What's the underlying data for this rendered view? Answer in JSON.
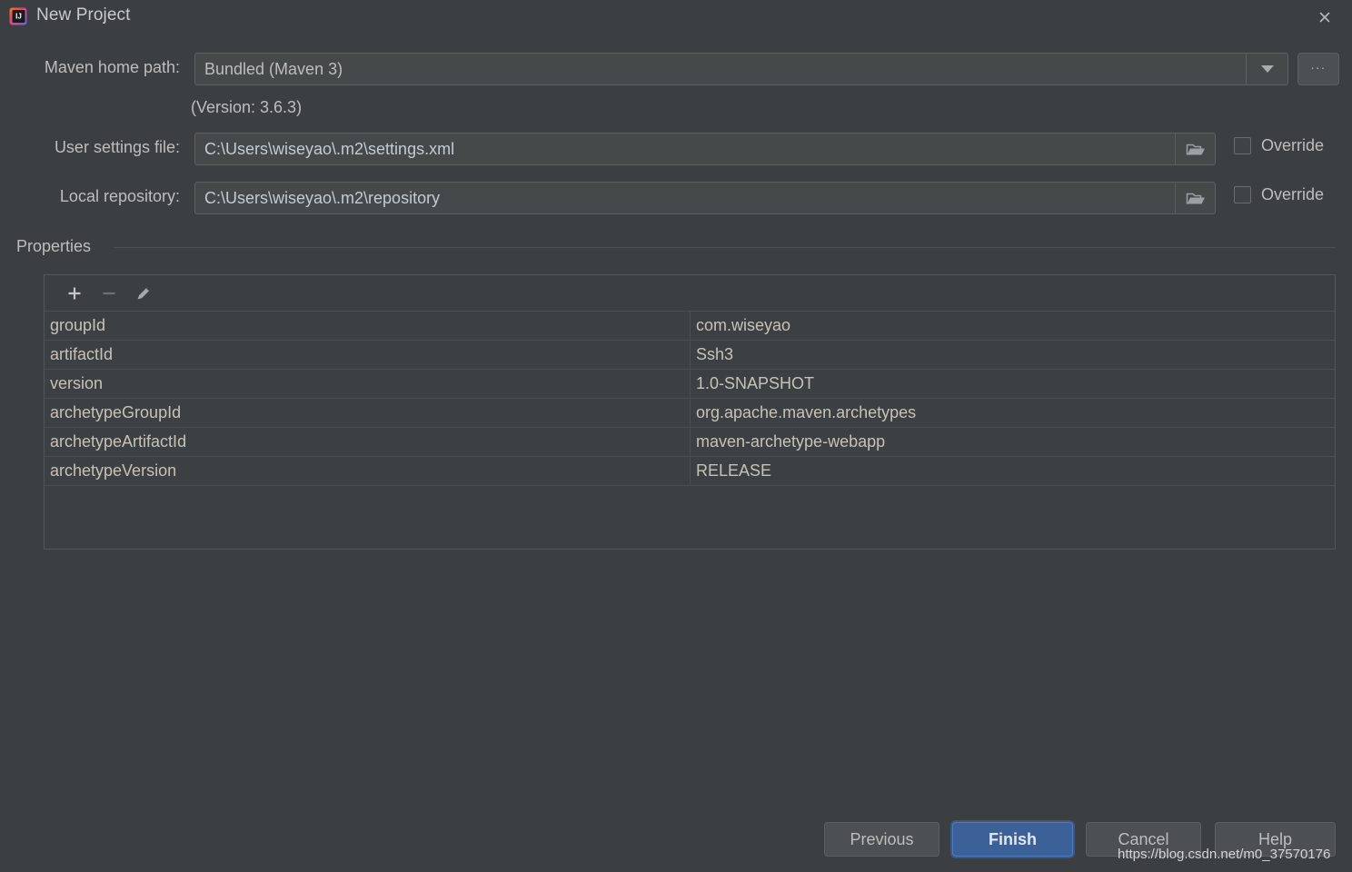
{
  "window": {
    "title": "New Project",
    "app_icon": "intellij-idea-icon",
    "close_icon": "close-icon",
    "background_color": "#3c3f41"
  },
  "form": {
    "maven_home": {
      "label": "Maven home path:",
      "value": "Bundled (Maven 3)",
      "dropdown_icon": "chevron-down-icon",
      "browse_label": "...",
      "version_note": "(Version: 3.6.3)"
    },
    "user_settings": {
      "label": "User settings file:",
      "value": "C:\\Users\\wiseyao\\.m2\\settings.xml",
      "folder_icon": "folder-icon",
      "override_label": "Override",
      "override_checked": false
    },
    "local_repository": {
      "label": "Local repository:",
      "value": "C:\\Users\\wiseyao\\.m2\\repository",
      "folder_icon": "folder-icon",
      "override_label": "Override",
      "override_checked": false
    }
  },
  "properties": {
    "section_title": "Properties",
    "toolbar": {
      "add_icon": "plus-icon",
      "remove_icon": "minus-icon",
      "edit_icon": "pencil-icon"
    },
    "rows": [
      {
        "key": "groupId",
        "value": "com.wiseyao"
      },
      {
        "key": "artifactId",
        "value": "Ssh3"
      },
      {
        "key": "version",
        "value": "1.0-SNAPSHOT"
      },
      {
        "key": "archetypeGroupId",
        "value": "org.apache.maven.archetypes"
      },
      {
        "key": "archetypeArtifactId",
        "value": "maven-archetype-webapp"
      },
      {
        "key": "archetypeVersion",
        "value": "RELEASE"
      }
    ]
  },
  "footer": {
    "previous_label": "Previous",
    "finish_label": "Finish",
    "cancel_label": "Cancel",
    "help_label": "Help",
    "finish_color": "#3c6199"
  },
  "watermark": {
    "text": "https://blog.csdn.net/m0_37570176"
  }
}
